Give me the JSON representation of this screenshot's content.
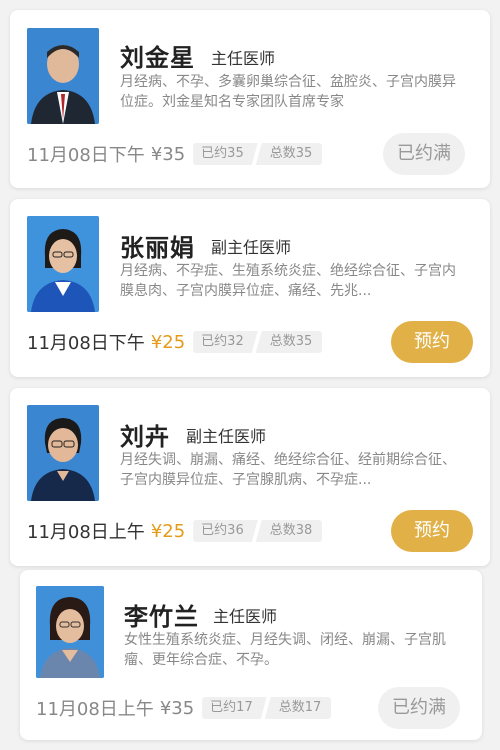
{
  "doctors": [
    {
      "name": "刘金星",
      "title": "主任医师",
      "desc": "月经病、不孕、多囊卵巢综合征、盆腔炎、子宫内膜异位症。刘金星知名专家团队首席专家",
      "date": "11月08日下午",
      "price": "¥35",
      "booked": "已约35",
      "total": "总数35",
      "action": "已约满"
    },
    {
      "name": "张丽娟",
      "title": "副主任医师",
      "desc": "月经病、不孕症、生殖系统炎症、绝经综合征、子宫内膜息肉、子宫内膜异位症、痛经、先兆...",
      "date": "11月08日下午",
      "price": "¥25",
      "booked": "已约32",
      "total": "总数35",
      "action": "预约"
    },
    {
      "name": "刘卉",
      "title": "副主任医师",
      "desc": "月经失调、崩漏、痛经、绝经综合征、经前期综合征、子宫内膜异位症、子宫腺肌病、不孕症...",
      "date": "11月08日上午",
      "price": "¥25",
      "booked": "已约36",
      "total": "总数38",
      "action": "预约"
    },
    {
      "name": "李竹兰",
      "title": "主任医师",
      "desc": "女性生殖系统炎症、月经失调、闭经、崩漏、子宫肌瘤、更年综合症、不孕。",
      "date": "11月08日上午",
      "price": "¥35",
      "booked": "已约17",
      "total": "总数17",
      "action": "已约满"
    }
  ],
  "colors": {
    "accent_button": "#e1b047",
    "price_available": "#e59a1a",
    "full_button_bg": "#f0f0f0"
  }
}
